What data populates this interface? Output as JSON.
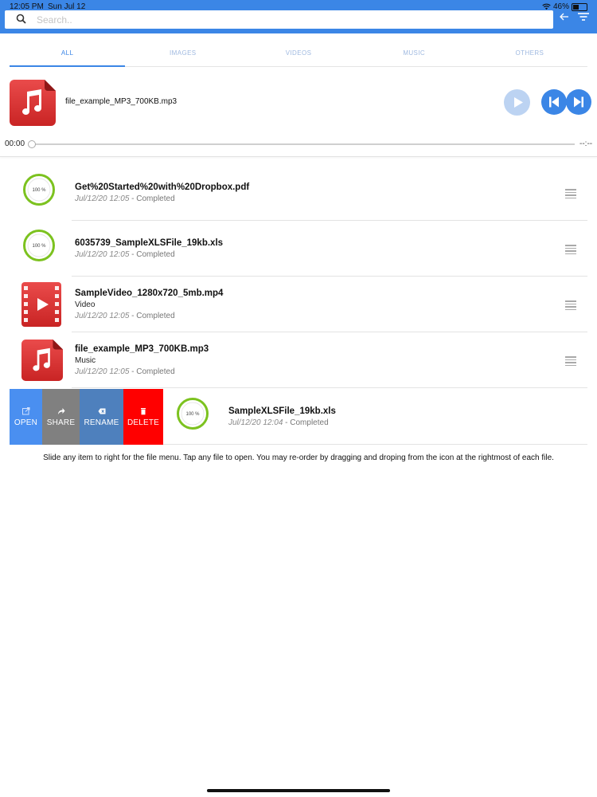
{
  "status_bar": {
    "time": "12:05 PM",
    "date": "Sun Jul 12",
    "battery": "46%"
  },
  "search": {
    "placeholder": "Search.."
  },
  "tabs": [
    {
      "label": "ALL",
      "active": true
    },
    {
      "label": "IMAGES",
      "active": false
    },
    {
      "label": "VIDEOS",
      "active": false
    },
    {
      "label": "MUSIC",
      "active": false
    },
    {
      "label": "OTHERS",
      "active": false
    }
  ],
  "player": {
    "file_name": "file_example_MP3_700KB.mp3",
    "time_current": "00:00",
    "time_total": "--:--",
    "progress": 0
  },
  "files": [
    {
      "name": "Get%20Started%20with%20Dropbox.pdf",
      "type": "",
      "date": "Jul/12/20 12:05",
      "status": " - Completed",
      "progress_label": "100 %",
      "icon": "progress-ring-icon"
    },
    {
      "name": "6035739_SampleXLSFile_19kb.xls",
      "type": "",
      "date": "Jul/12/20 12:05",
      "status": " - Completed",
      "progress_label": "100 %",
      "icon": "progress-ring-icon"
    },
    {
      "name": "SampleVideo_1280x720_5mb.mp4",
      "type": "Video",
      "date": "Jul/12/20 12:05",
      "status": " - Completed",
      "icon": "video-file-icon"
    },
    {
      "name": "file_example_MP3_700KB.mp3",
      "type": "Music",
      "date": "Jul/12/20 12:05",
      "status": " - Completed",
      "icon": "music-file-icon"
    },
    {
      "name": "SampleXLSFile_19kb.xls",
      "type": "",
      "date": "Jul/12/20 12:04",
      "status": " - Completed",
      "progress_label": "100 %",
      "icon": "progress-ring-icon"
    }
  ],
  "actions": {
    "open": "OPEN",
    "share": "SHARE",
    "rename": "RENAME",
    "delete": "DELETE"
  },
  "colors": {
    "primary": "#3b86e6",
    "open": "#4a8ff0",
    "share": "#808080",
    "rename": "#4e80bd",
    "delete": "#ff0000",
    "progress_ring": "#7cc21f",
    "file_icon_red": "#e03a3a"
  },
  "hint": "Slide any item to right for the file menu. Tap any file to open. You may re-order by dragging and droping from the icon at the rightmost of each file."
}
